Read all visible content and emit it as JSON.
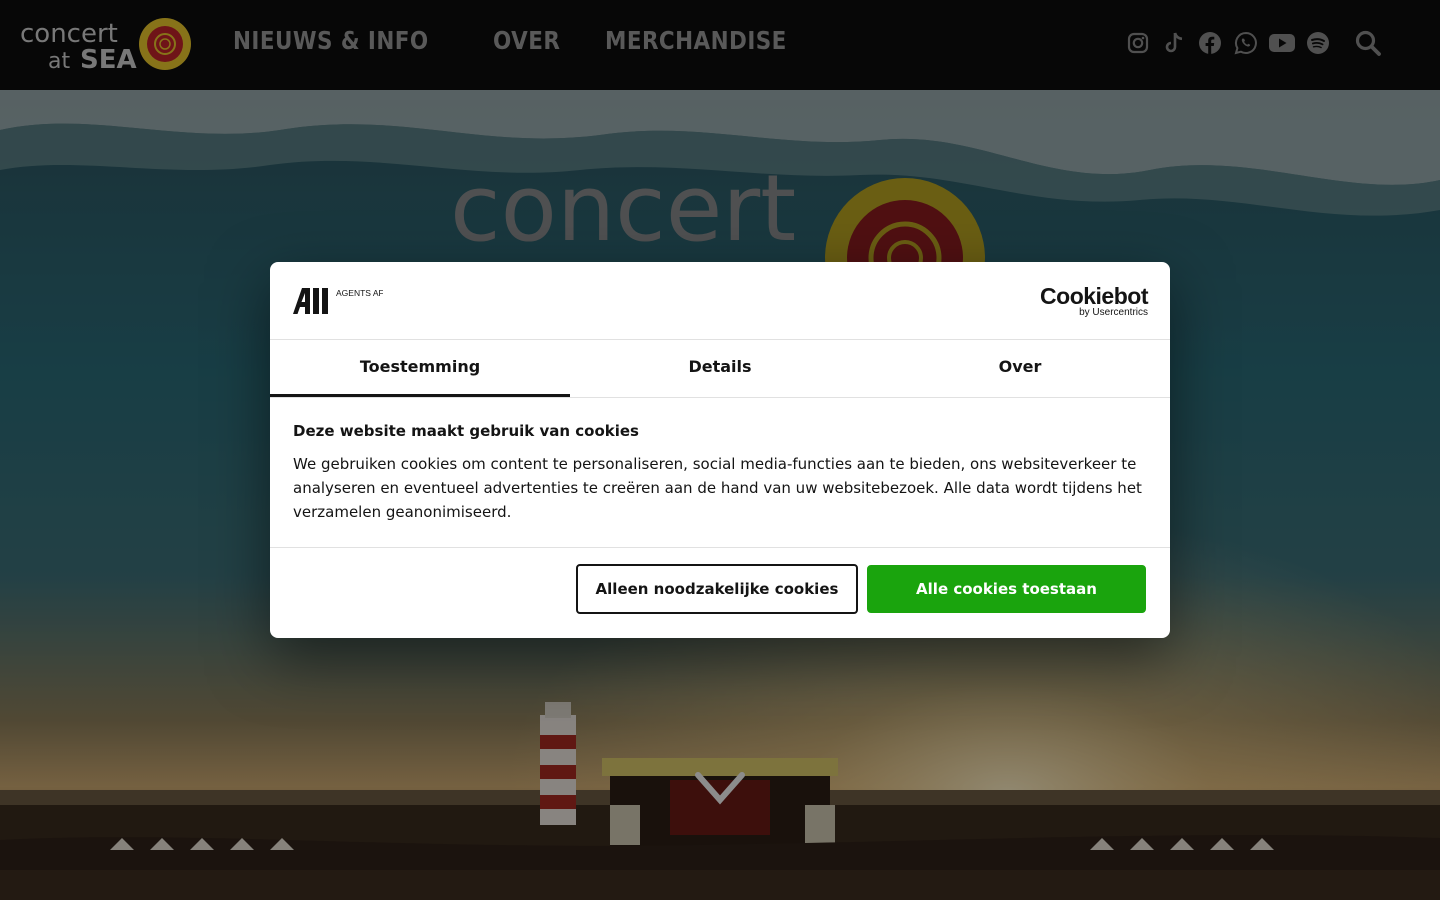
{
  "header": {
    "logo_text": "concert at SEA",
    "nav": [
      "NIEUWS & INFO",
      "OVER",
      "MERCHANDISE"
    ],
    "social_icons": [
      "instagram-icon",
      "tiktok-icon",
      "facebook-icon",
      "whatsapp-icon",
      "youtube-icon",
      "spotify-icon"
    ],
    "search_icon": "search-icon"
  },
  "hero": {
    "logo_text": "concert at SEA",
    "scroll_icon": "chevron-down-icon"
  },
  "cookie_dialog": {
    "brand_logo_text": "AGENTS AFTER ALL",
    "provider": {
      "name": "Cookiebot",
      "sub": "by Usercentrics"
    },
    "tabs": [
      "Toestemming",
      "Details",
      "Over"
    ],
    "active_tab": "Toestemming",
    "title": "Deze website maakt gebruik van cookies",
    "text": "We gebruiken cookies om content te personaliseren, social media-functies aan te bieden, ons websiteverkeer te analyseren en eventueel advertenties te creëren aan de hand van uw websitebezoek. Alle data wordt tijdens het verzamelen geanonimiseerd.",
    "btn_necessary": "Alleen noodzakelijke cookies",
    "btn_all": "Alle cookies toestaan"
  },
  "colors": {
    "accept_green": "#1aa40d",
    "logo_yellow": "#e8c72c",
    "logo_red": "#c0242a"
  }
}
